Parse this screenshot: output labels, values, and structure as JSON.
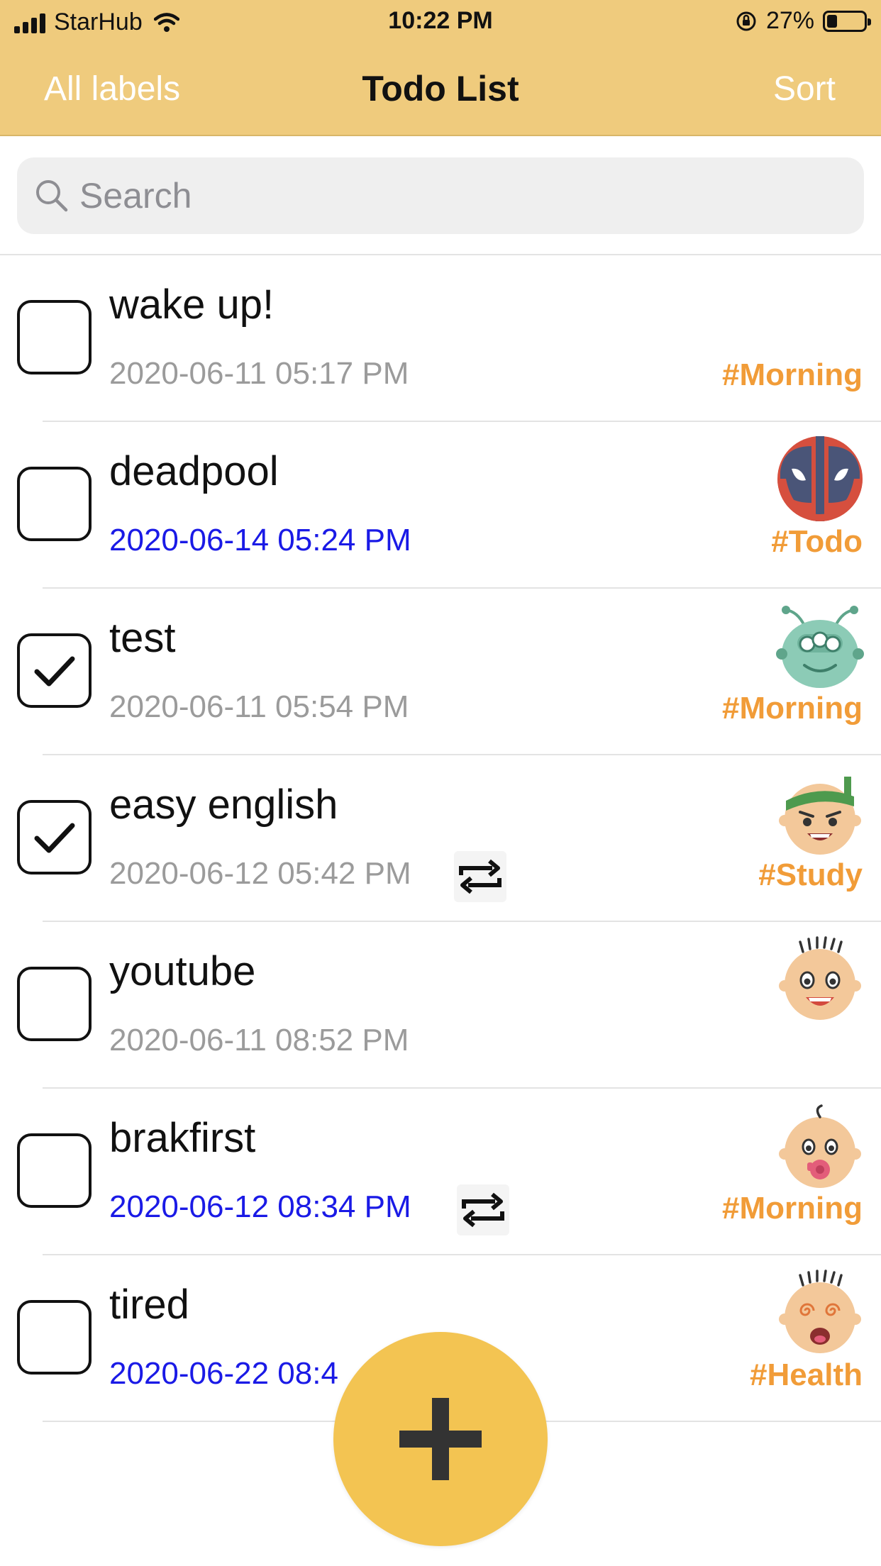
{
  "status_bar": {
    "carrier": "StarHub",
    "time": "10:22 PM",
    "battery": "27%"
  },
  "nav": {
    "left": "All labels",
    "title": "Todo List",
    "right": "Sort"
  },
  "search": {
    "placeholder": "Search"
  },
  "todos": [
    {
      "title": "wake up!",
      "date": "2020-06-11 05:17 PM",
      "label": "#Morning",
      "checked": false,
      "due": false,
      "repeat": false,
      "avatar": "none"
    },
    {
      "title": "deadpool",
      "date": "2020-06-14 05:24 PM",
      "label": "#Todo",
      "checked": false,
      "due": true,
      "repeat": false,
      "avatar": "deadpool-mask-icon"
    },
    {
      "title": "test",
      "date": "2020-06-11 05:54 PM",
      "label": "#Morning",
      "checked": true,
      "due": false,
      "repeat": false,
      "avatar": "alien-face-icon"
    },
    {
      "title": "easy english",
      "date": "2020-06-12 05:42 PM",
      "label": "#Study",
      "checked": true,
      "due": false,
      "repeat": true,
      "avatar": "headband-face-icon"
    },
    {
      "title": "youtube",
      "date": "2020-06-11 08:52 PM",
      "label": "",
      "checked": false,
      "due": false,
      "repeat": false,
      "avatar": "excited-face-icon"
    },
    {
      "title": "brakfirst",
      "date": "2020-06-12 08:34 PM",
      "label": "#Morning",
      "checked": false,
      "due": true,
      "repeat": true,
      "avatar": "baby-face-icon"
    },
    {
      "title": "tired",
      "date": "2020-06-22 08:4",
      "label": "#Health",
      "checked": false,
      "due": true,
      "repeat": false,
      "avatar": "dizzy-face-icon"
    }
  ],
  "colors": {
    "header": "#EFCB7D",
    "label": "#F19C38",
    "due_date": "#1a1ae6",
    "fab": "#F3C452"
  },
  "fab": {
    "icon": "plus-icon"
  }
}
